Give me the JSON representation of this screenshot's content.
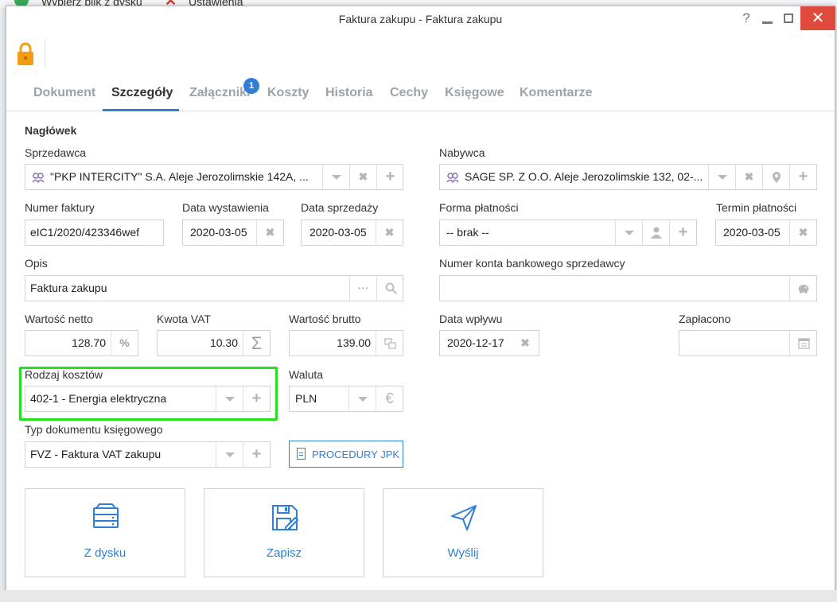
{
  "background": {
    "item1": "Wybierz plik z dysku",
    "item2": "Ustawienia"
  },
  "window": {
    "title": "Faktura zakupu - Faktura zakupu",
    "help": "?",
    "close": "✕"
  },
  "tabs": [
    {
      "label": "Dokument"
    },
    {
      "label": "Szczegóły"
    },
    {
      "label": "Załączniki",
      "badge": "1"
    },
    {
      "label": "Koszty"
    },
    {
      "label": "Historia"
    },
    {
      "label": "Cechy"
    },
    {
      "label": "Księgowe"
    },
    {
      "label": "Komentarze"
    }
  ],
  "section": {
    "title": "Nagłówek"
  },
  "form": {
    "seller": {
      "label": "Sprzedawca",
      "value": "\"PKP INTERCITY\" S.A. Aleje Jerozolimskie 142A, ..."
    },
    "buyer": {
      "label": "Nabywca",
      "value": "SAGE SP. Z O.O. Aleje Jerozolimskie 132, 02-..."
    },
    "invoice_number": {
      "label": "Numer faktury",
      "value": "eIC1/2020/423346wef"
    },
    "issue_date": {
      "label": "Data wystawienia",
      "value": "2020-03-05"
    },
    "sale_date": {
      "label": "Data sprzedaży",
      "value": "2020-03-05"
    },
    "payment_form": {
      "label": "Forma płatności",
      "value": "-- brak --"
    },
    "payment_term": {
      "label": "Termin płatności",
      "value": "2020-03-05"
    },
    "description": {
      "label": "Opis",
      "value": "Faktura zakupu",
      "dots": "···"
    },
    "bank_account": {
      "label": "Numer konta bankowego sprzedawcy",
      "value": ""
    },
    "net_value": {
      "label": "Wartość netto",
      "value": "128.70",
      "suffix": "%"
    },
    "vat_amount": {
      "label": "Kwota VAT",
      "value": "10.30",
      "suffix": "Σ"
    },
    "gross_value": {
      "label": "Wartość brutto",
      "value": "139.00"
    },
    "receipt_date": {
      "label": "Data wpływu",
      "value": "2020-12-17"
    },
    "paid": {
      "label": "Zapłacono",
      "value": ""
    },
    "cost_type": {
      "label": "Rodzaj kosztów",
      "value": "402-1 - Energia elektryczna"
    },
    "currency": {
      "label": "Waluta",
      "value": "PLN",
      "suffix": "€"
    },
    "doc_type": {
      "label": "Typ dokumentu księgowego",
      "value": "FVZ - Faktura VAT zakupu"
    }
  },
  "buttons": {
    "jpk": "PROCEDURY JPK",
    "from_disk": "Z dysku",
    "save": "Zapisz",
    "send": "Wyślij"
  },
  "glyphs": {
    "x": "✖",
    "plus": "+"
  },
  "colors": {
    "accent": "#2f7fd6",
    "highlight": "#27e01f",
    "close": "#e04a3c",
    "lock": "#f39c12"
  }
}
